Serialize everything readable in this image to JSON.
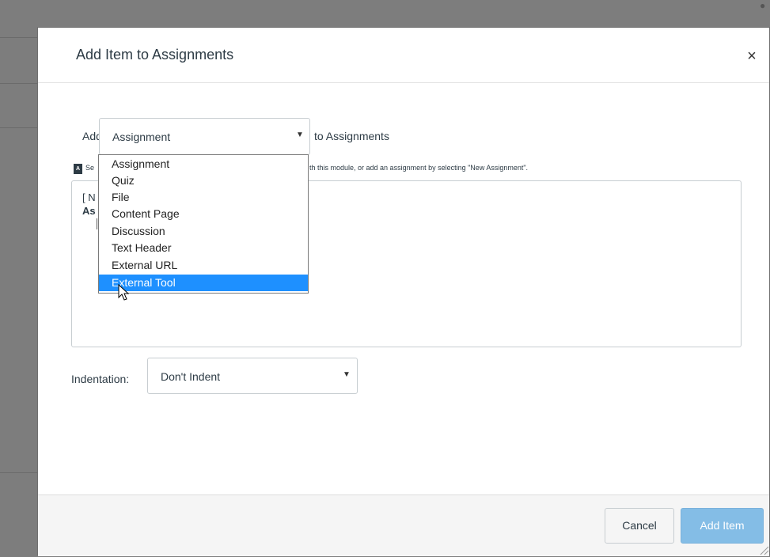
{
  "dialog": {
    "title": "Add Item to Assignments",
    "close_label": "×"
  },
  "form": {
    "add_label": "Add",
    "item_type_selected": "Assignment",
    "to_label": "to Assignments",
    "help_text_left": "Se",
    "help_text_right": "th this module, or add an assignment by selecting \"New Assignment\".",
    "help_icon_text": "A",
    "list_line1": "[ N",
    "list_line2": "As",
    "indentation_label": "Indentation:",
    "indentation_selected": "Don't Indent"
  },
  "dropdown": {
    "options": [
      "Assignment",
      "Quiz",
      "File",
      "Content Page",
      "Discussion",
      "Text Header",
      "External URL",
      "External Tool"
    ],
    "highlighted": "External Tool",
    "highlight_color": "#1e90ff"
  },
  "footer": {
    "cancel_label": "Cancel",
    "add_label": "Add Item",
    "add_color": "#84bde6"
  },
  "icons": {
    "close": "close-icon",
    "dropdown": "chevron-down-icon",
    "help": "help-icon",
    "cursor": "mouse-pointer-icon"
  }
}
